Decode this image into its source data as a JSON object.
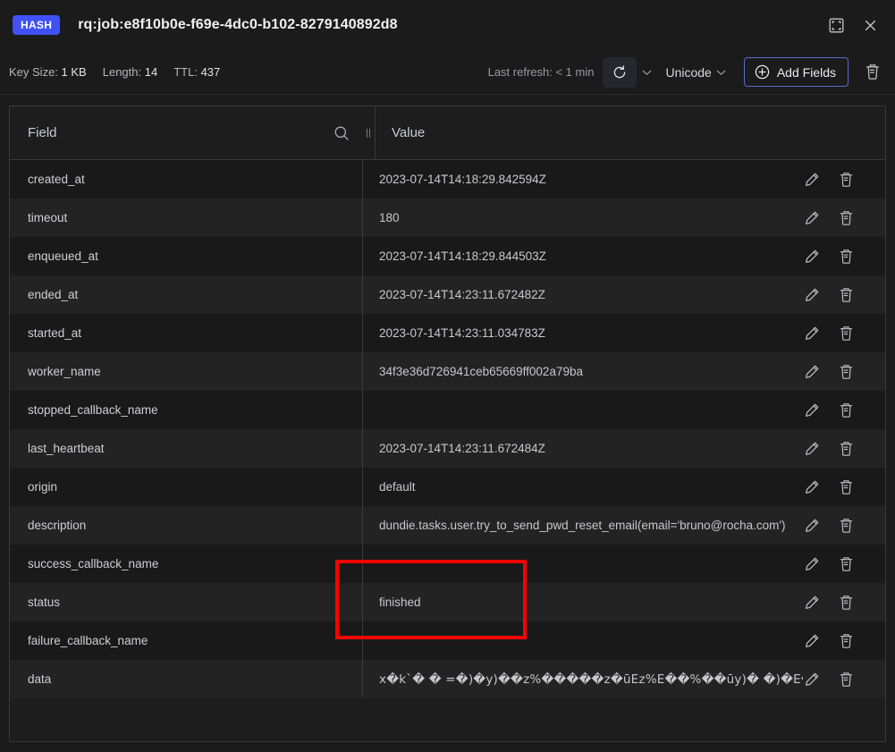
{
  "header": {
    "badge": "HASH",
    "key_name": "rq:job:e8f10b0e-f69e-4dc0-b102-8279140892d8",
    "fullscreen_icon": "fullscreen-icon",
    "close_icon": "close-icon"
  },
  "meta": {
    "key_size_label": "Key Size:",
    "key_size_value": "1 KB",
    "length_label": "Length:",
    "length_value": "14",
    "ttl_label": "TTL:",
    "ttl_value": "437"
  },
  "toolbar": {
    "last_refresh": "Last refresh: < 1 min",
    "refresh_icon": "refresh-icon",
    "refresh_caret": "chevron-down-icon",
    "encoding": "Unicode",
    "encoding_caret": "chevron-down-icon",
    "add_fields_label": "Add Fields",
    "add_fields_icon": "plus-circle-icon",
    "delete_key_icon": "trash-icon"
  },
  "table": {
    "columns": {
      "field": "Field",
      "value": "Value"
    },
    "search_icon": "search-icon",
    "resize_handle": "column-resize-handle",
    "row_edit_icon": "pencil-icon",
    "row_delete_icon": "trash-icon",
    "rows": [
      {
        "field": "created_at",
        "value": "2023-07-14T14:18:29.842594Z"
      },
      {
        "field": "timeout",
        "value": "180"
      },
      {
        "field": "enqueued_at",
        "value": "2023-07-14T14:18:29.844503Z"
      },
      {
        "field": "ended_at",
        "value": "2023-07-14T14:23:11.672482Z"
      },
      {
        "field": "started_at",
        "value": "2023-07-14T14:23:11.034783Z"
      },
      {
        "field": "worker_name",
        "value": "34f3e36d726941ceb65669ff002a79ba"
      },
      {
        "field": "stopped_callback_name",
        "value": ""
      },
      {
        "field": "last_heartbeat",
        "value": "2023-07-14T14:23:11.672484Z"
      },
      {
        "field": "origin",
        "value": "default"
      },
      {
        "field": "description",
        "value": "dundie.tasks.user.try_to_send_pwd_reset_email(email='bruno@rocha.com')"
      },
      {
        "field": "success_callback_name",
        "value": ""
      },
      {
        "field": "status",
        "value": "finished"
      },
      {
        "field": "failure_callback_name",
        "value": ""
      },
      {
        "field": "data",
        "value": "x�k`� �  =�)�y)��z%�����z�ūEz%E��%��ūy)�  �)�E�ū%  …"
      }
    ]
  },
  "annotation": {
    "highlight_color": "#ff0000",
    "highlight_target": "status"
  },
  "colors": {
    "badge": "#3f51f7",
    "accent_border": "#5b69cf",
    "page_bg": "#1b1b1b",
    "row_odd": "#191919",
    "row_even": "#232323"
  }
}
